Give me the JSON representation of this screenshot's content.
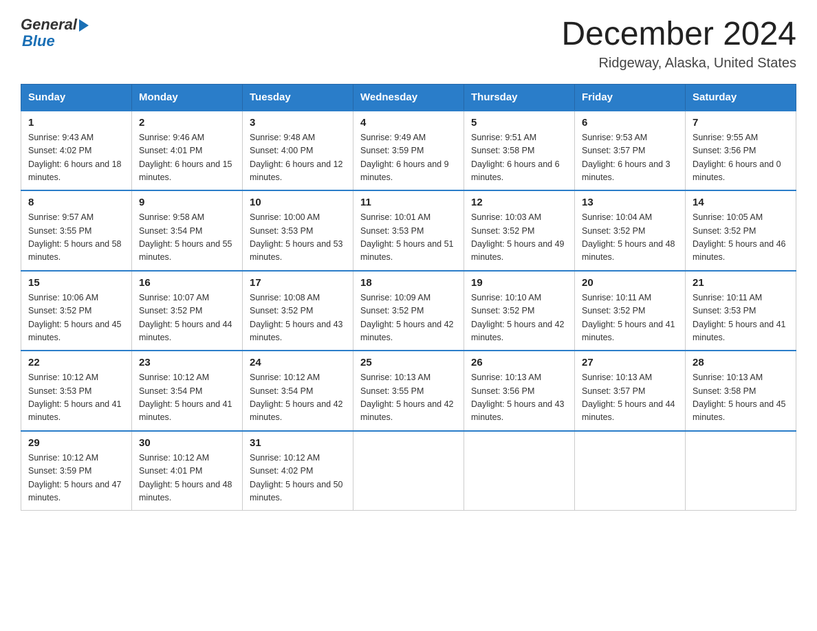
{
  "logo": {
    "general": "General",
    "blue": "Blue"
  },
  "title": "December 2024",
  "subtitle": "Ridgeway, Alaska, United States",
  "days_of_week": [
    "Sunday",
    "Monday",
    "Tuesday",
    "Wednesday",
    "Thursday",
    "Friday",
    "Saturday"
  ],
  "weeks": [
    [
      {
        "day": "1",
        "sunrise": "9:43 AM",
        "sunset": "4:02 PM",
        "daylight": "6 hours and 18 minutes."
      },
      {
        "day": "2",
        "sunrise": "9:46 AM",
        "sunset": "4:01 PM",
        "daylight": "6 hours and 15 minutes."
      },
      {
        "day": "3",
        "sunrise": "9:48 AM",
        "sunset": "4:00 PM",
        "daylight": "6 hours and 12 minutes."
      },
      {
        "day": "4",
        "sunrise": "9:49 AM",
        "sunset": "3:59 PM",
        "daylight": "6 hours and 9 minutes."
      },
      {
        "day": "5",
        "sunrise": "9:51 AM",
        "sunset": "3:58 PM",
        "daylight": "6 hours and 6 minutes."
      },
      {
        "day": "6",
        "sunrise": "9:53 AM",
        "sunset": "3:57 PM",
        "daylight": "6 hours and 3 minutes."
      },
      {
        "day": "7",
        "sunrise": "9:55 AM",
        "sunset": "3:56 PM",
        "daylight": "6 hours and 0 minutes."
      }
    ],
    [
      {
        "day": "8",
        "sunrise": "9:57 AM",
        "sunset": "3:55 PM",
        "daylight": "5 hours and 58 minutes."
      },
      {
        "day": "9",
        "sunrise": "9:58 AM",
        "sunset": "3:54 PM",
        "daylight": "5 hours and 55 minutes."
      },
      {
        "day": "10",
        "sunrise": "10:00 AM",
        "sunset": "3:53 PM",
        "daylight": "5 hours and 53 minutes."
      },
      {
        "day": "11",
        "sunrise": "10:01 AM",
        "sunset": "3:53 PM",
        "daylight": "5 hours and 51 minutes."
      },
      {
        "day": "12",
        "sunrise": "10:03 AM",
        "sunset": "3:52 PM",
        "daylight": "5 hours and 49 minutes."
      },
      {
        "day": "13",
        "sunrise": "10:04 AM",
        "sunset": "3:52 PM",
        "daylight": "5 hours and 48 minutes."
      },
      {
        "day": "14",
        "sunrise": "10:05 AM",
        "sunset": "3:52 PM",
        "daylight": "5 hours and 46 minutes."
      }
    ],
    [
      {
        "day": "15",
        "sunrise": "10:06 AM",
        "sunset": "3:52 PM",
        "daylight": "5 hours and 45 minutes."
      },
      {
        "day": "16",
        "sunrise": "10:07 AM",
        "sunset": "3:52 PM",
        "daylight": "5 hours and 44 minutes."
      },
      {
        "day": "17",
        "sunrise": "10:08 AM",
        "sunset": "3:52 PM",
        "daylight": "5 hours and 43 minutes."
      },
      {
        "day": "18",
        "sunrise": "10:09 AM",
        "sunset": "3:52 PM",
        "daylight": "5 hours and 42 minutes."
      },
      {
        "day": "19",
        "sunrise": "10:10 AM",
        "sunset": "3:52 PM",
        "daylight": "5 hours and 42 minutes."
      },
      {
        "day": "20",
        "sunrise": "10:11 AM",
        "sunset": "3:52 PM",
        "daylight": "5 hours and 41 minutes."
      },
      {
        "day": "21",
        "sunrise": "10:11 AM",
        "sunset": "3:53 PM",
        "daylight": "5 hours and 41 minutes."
      }
    ],
    [
      {
        "day": "22",
        "sunrise": "10:12 AM",
        "sunset": "3:53 PM",
        "daylight": "5 hours and 41 minutes."
      },
      {
        "day": "23",
        "sunrise": "10:12 AM",
        "sunset": "3:54 PM",
        "daylight": "5 hours and 41 minutes."
      },
      {
        "day": "24",
        "sunrise": "10:12 AM",
        "sunset": "3:54 PM",
        "daylight": "5 hours and 42 minutes."
      },
      {
        "day": "25",
        "sunrise": "10:13 AM",
        "sunset": "3:55 PM",
        "daylight": "5 hours and 42 minutes."
      },
      {
        "day": "26",
        "sunrise": "10:13 AM",
        "sunset": "3:56 PM",
        "daylight": "5 hours and 43 minutes."
      },
      {
        "day": "27",
        "sunrise": "10:13 AM",
        "sunset": "3:57 PM",
        "daylight": "5 hours and 44 minutes."
      },
      {
        "day": "28",
        "sunrise": "10:13 AM",
        "sunset": "3:58 PM",
        "daylight": "5 hours and 45 minutes."
      }
    ],
    [
      {
        "day": "29",
        "sunrise": "10:12 AM",
        "sunset": "3:59 PM",
        "daylight": "5 hours and 47 minutes."
      },
      {
        "day": "30",
        "sunrise": "10:12 AM",
        "sunset": "4:01 PM",
        "daylight": "5 hours and 48 minutes."
      },
      {
        "day": "31",
        "sunrise": "10:12 AM",
        "sunset": "4:02 PM",
        "daylight": "5 hours and 50 minutes."
      },
      null,
      null,
      null,
      null
    ]
  ],
  "labels": {
    "sunrise": "Sunrise:",
    "sunset": "Sunset:",
    "daylight": "Daylight:"
  }
}
